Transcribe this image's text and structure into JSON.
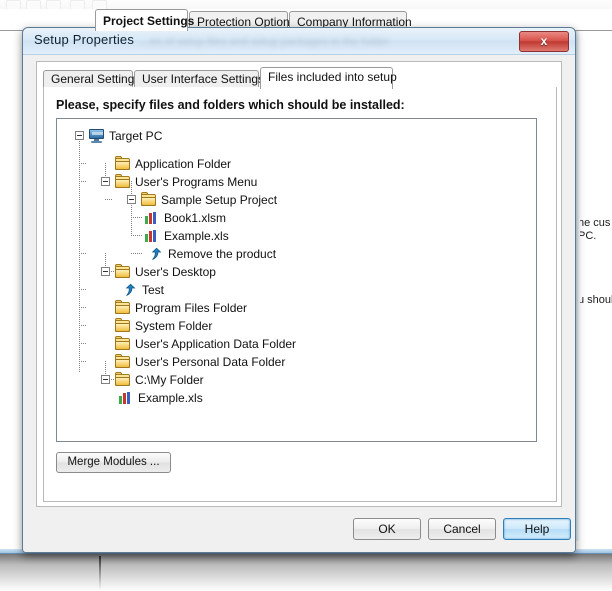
{
  "app": {
    "tabs": [
      {
        "label": "Project Settings",
        "selected": true
      },
      {
        "label": "Protection Options",
        "selected": false
      },
      {
        "label": "Company Information",
        "selected": false
      }
    ],
    "background_text_1": "he cus",
    "background_text_2": "PC.",
    "background_text_3": "u shoul"
  },
  "dialog": {
    "title": "Setup Properties",
    "blurred_subtitle": "...es of setup files and setup packages in the folder",
    "close_label": "x",
    "tabs": [
      {
        "label": "General Settings",
        "selected": false
      },
      {
        "label": "User Interface Settings",
        "selected": false
      },
      {
        "label": "Files included into setup",
        "selected": true
      }
    ],
    "prompt": "Please, specify files and folders which should be installed:",
    "merge_modules_label": "Merge Modules ...",
    "ok_label": "OK",
    "cancel_label": "Cancel",
    "help_label": "Help"
  },
  "tree": {
    "nodes": [
      {
        "label": "Target PC",
        "icon": "computer-icon",
        "depth": 0,
        "expander": "collapse"
      },
      {
        "label": "Application Folder",
        "icon": "folder-icon",
        "depth": 1,
        "expander": "none"
      },
      {
        "label": "User's Programs Menu",
        "icon": "folder-icon",
        "depth": 1,
        "expander": "collapse"
      },
      {
        "label": "Sample Setup Project",
        "icon": "folder-icon",
        "depth": 2,
        "expander": "collapse"
      },
      {
        "label": "Book1.xlsm",
        "icon": "excel-file-icon",
        "depth": 3,
        "expander": "none"
      },
      {
        "label": "Example.xls",
        "icon": "excel-file-icon",
        "depth": 3,
        "expander": "none"
      },
      {
        "label": "Remove the product",
        "icon": "shortcut-icon",
        "depth": 3,
        "expander": "none"
      },
      {
        "label": "User's Desktop",
        "icon": "folder-icon",
        "depth": 1,
        "expander": "collapse"
      },
      {
        "label": "Test",
        "icon": "shortcut-icon",
        "depth": 2,
        "expander": "none"
      },
      {
        "label": "Program Files Folder",
        "icon": "folder-icon",
        "depth": 1,
        "expander": "none"
      },
      {
        "label": "System Folder",
        "icon": "folder-icon",
        "depth": 1,
        "expander": "none"
      },
      {
        "label": "User's Application Data Folder",
        "icon": "folder-icon",
        "depth": 1,
        "expander": "none"
      },
      {
        "label": "User's Personal Data Folder",
        "icon": "folder-icon",
        "depth": 1,
        "expander": "none"
      },
      {
        "label": "C:\\My Folder",
        "icon": "folder-icon",
        "depth": 1,
        "expander": "collapse"
      },
      {
        "label": "Example.xls",
        "icon": "excel-file-icon",
        "depth": 2,
        "expander": "none"
      }
    ]
  },
  "colors": {
    "dialog_title_bg": "#d7e8f6",
    "close_button": "#c03a32",
    "folder": "#f4c752",
    "accent_focus": "#2f7fbd"
  }
}
